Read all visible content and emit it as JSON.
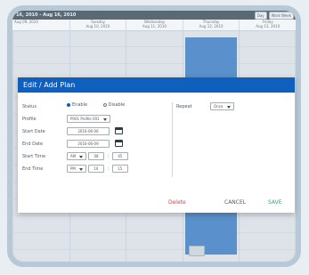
{
  "calendar": {
    "title": "16, 2010 - Aug 16, 2010",
    "view_controls": [
      "Day",
      "Work Week"
    ],
    "days": [
      {
        "name": "",
        "date": "Aug 09, 2010"
      },
      {
        "name": "Tuesday",
        "date": "Aug 10, 2010"
      },
      {
        "name": "Wednesday",
        "date": "Aug 11, 2010"
      },
      {
        "name": "Thursday",
        "date": "Aug 12, 2010"
      },
      {
        "name": "Friday",
        "date": "Aug 13, 2010"
      }
    ]
  },
  "modal": {
    "title": "Edit / Add Plan",
    "status": {
      "label": "Status",
      "enable_label": "Enable",
      "disable_label": "Disable",
      "selected": "Enable"
    },
    "profile": {
      "label": "Profile",
      "value": "P001 Profile 001"
    },
    "start_date": {
      "label": "Start Date",
      "value": "2016-06-06"
    },
    "end_date": {
      "label": "End Date",
      "value": "2016-06-09"
    },
    "start_time": {
      "label": "Start Time",
      "ampm": "AM",
      "hour": "08",
      "minute": "45"
    },
    "end_time": {
      "label": "End Time",
      "ampm": "PM",
      "hour": "10",
      "minute": "15"
    },
    "repeat": {
      "label": "Repeat",
      "value": "Once"
    },
    "buttons": {
      "delete": "Delete",
      "cancel": "CANCEL",
      "save": "SAVE"
    }
  },
  "colors": {
    "primary": "#0f5fbe",
    "save": "#3aa86b",
    "delete": "#c44c4c",
    "event": "#4b86c9"
  },
  "icons": {
    "calendar": "calendar-icon",
    "caret": "caret-down-icon"
  }
}
